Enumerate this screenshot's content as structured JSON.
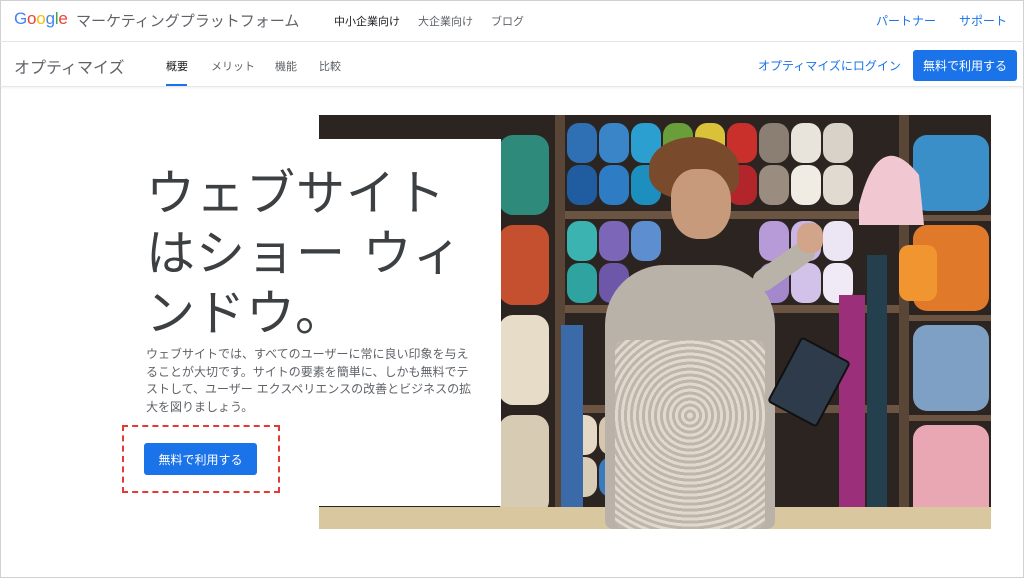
{
  "header": {
    "logo_text": "Google",
    "platform_name": "マーケティングプラットフォーム",
    "nav": [
      "中小企業向け",
      "大企業向け",
      "ブログ"
    ],
    "right_links": [
      "パートナー",
      "サポート"
    ]
  },
  "subnav": {
    "product_name": "オプティマイズ",
    "tabs": [
      "概要",
      "メリット",
      "機能",
      "比較"
    ],
    "active_tab": "概要",
    "login_label": "オプティマイズにログイン",
    "cta_label": "無料で利用する"
  },
  "hero": {
    "headline_lines": [
      "ウェブサイト",
      "はショー ウィ",
      "ンドウ。"
    ],
    "body": "ウェブサイトでは、すべてのユーザーに常に良い印象を与えることが大切です。サイトの要素を簡単に、しかも無料でテストして、ユーザー エクスペリエンスの改善とビジネスの拡大を図りましょう。",
    "cta_label": "無料で利用する"
  },
  "colors": {
    "accent": "#1a73e8",
    "highlight_border": "#e53935",
    "google_blue": "#4285f4",
    "google_red": "#ea4335",
    "google_yellow": "#fbbc05",
    "google_green": "#34a853"
  }
}
